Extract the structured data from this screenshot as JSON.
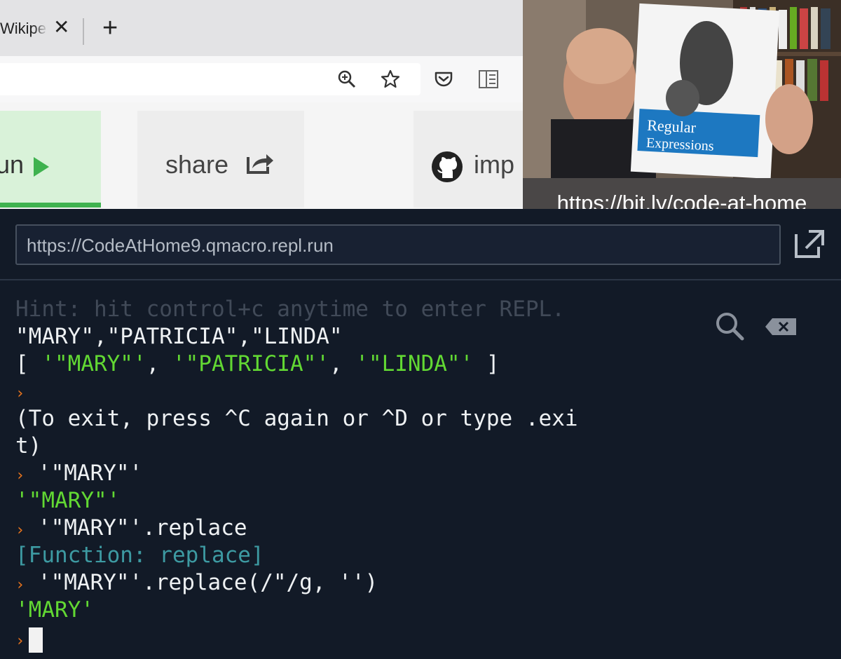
{
  "browser": {
    "tab_title": "Wikipe",
    "tab_close": "✕",
    "new_tab": "+"
  },
  "toolbar": {
    "run_label": "un",
    "share_label": "share",
    "import_label": "imp"
  },
  "webcam": {
    "caption": "https://bit.ly/code-at-home"
  },
  "console": {
    "url": "https://CodeAtHome9.qmacro.repl.run",
    "prompt_glyph": "›",
    "lines": {
      "hint": "Hint: hit control+c anytime to enter REPL.",
      "l1": "\"MARY\",\"PATRICIA\",\"LINDA\"",
      "l2_open": "[ ",
      "l2_a": "'\"MARY\"'",
      "l2_sep1": ", ",
      "l2_b": "'\"PATRICIA\"'",
      "l2_sep2": ", ",
      "l2_c": "'\"LINDA\"'",
      "l2_close": " ]",
      "l4": "(To exit, press ^C again or ^D or type .exi",
      "l5": "t)",
      "l6_cmd": " '\"MARY\"'",
      "l7": "'\"MARY\"'",
      "l8_cmd": " '\"MARY\"'.replace",
      "l9": "[Function: replace]",
      "l10_cmd": " '\"MARY\"'.replace(/\"/g, '')",
      "l11": "'MARY'"
    }
  },
  "colors": {
    "terminal_bg": "#121a27",
    "prompt": "#e8741d",
    "string_green": "#62d833",
    "function_teal": "#3d9aa2",
    "run_green": "#3fb24f"
  }
}
